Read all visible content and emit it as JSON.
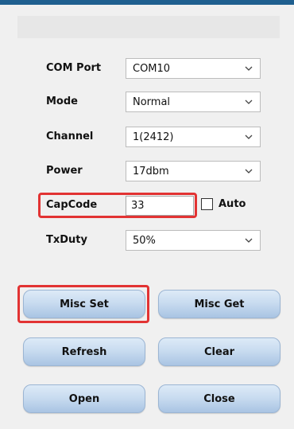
{
  "fields": {
    "com_port": {
      "label": "COM Port",
      "value": "COM10"
    },
    "mode": {
      "label": "Mode",
      "value": "Normal"
    },
    "channel": {
      "label": "Channel",
      "value": "1(2412)"
    },
    "power": {
      "label": "Power",
      "value": "17dbm"
    },
    "capcode": {
      "label": "CapCode",
      "value": "33",
      "auto_label": "Auto"
    },
    "txduty": {
      "label": "TxDuty",
      "value": "50%"
    }
  },
  "buttons": {
    "misc_set": "Misc Set",
    "misc_get": "Misc Get",
    "refresh": "Refresh",
    "clear": "Clear",
    "open": "Open",
    "close": "Close"
  },
  "colors": {
    "highlight": "#e23333",
    "title_bar": "#1f5f8f",
    "button_gradient_top": "#ddeaf7",
    "button_gradient_bottom": "#a9c4e3"
  },
  "icons": {
    "dropdown": "chevron-down-icon"
  }
}
